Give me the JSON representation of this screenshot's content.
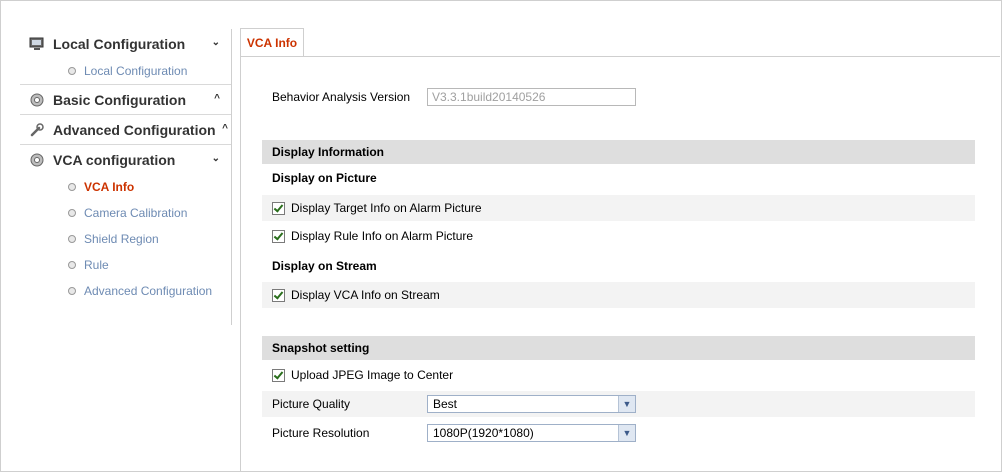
{
  "sidebar": {
    "local_header": "Local Configuration",
    "local_items": [
      "Local Configuration"
    ],
    "basic_header": "Basic Configuration",
    "advanced_header": "Advanced Configuration",
    "vca_header": "VCA configuration",
    "vca_items": [
      "VCA Info",
      "Camera Calibration",
      "Shield Region",
      "Rule",
      "Advanced Configuration"
    ],
    "active_item": "VCA Info",
    "chevrons": {
      "expanded": "⌄",
      "collapsed": "^"
    }
  },
  "tab": {
    "label": "VCA Info"
  },
  "version": {
    "label": "Behavior Analysis Version",
    "value": "V3.3.1build20140526"
  },
  "display_info": {
    "title": "Display Information",
    "on_picture_title": "Display on Picture",
    "target_info_label": "Display Target Info on Alarm Picture",
    "target_info_checked": true,
    "rule_info_label": "Display Rule Info on Alarm Picture",
    "rule_info_checked": true,
    "on_stream_title": "Display on Stream",
    "vca_info_stream_label": "Display VCA Info on Stream",
    "vca_info_stream_checked": true
  },
  "snapshot": {
    "title": "Snapshot setting",
    "upload_label": "Upload JPEG Image to Center",
    "upload_checked": true,
    "quality_label": "Picture Quality",
    "quality_value": "Best",
    "resolution_label": "Picture Resolution",
    "resolution_value": "1080P(1920*1080)"
  },
  "colors": {
    "active": "#cc3300",
    "link": "#6e8bb3",
    "section_bg": "#dedede",
    "row_shade": "#f3f3f3"
  }
}
